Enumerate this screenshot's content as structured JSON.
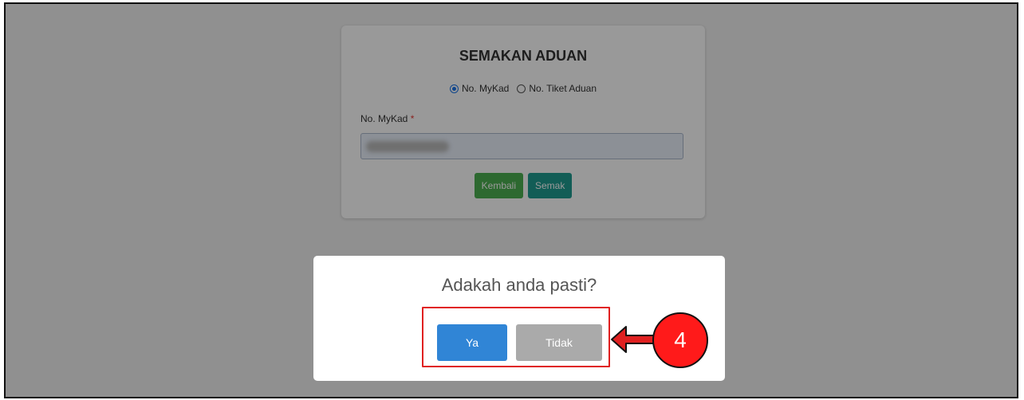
{
  "form": {
    "title": "SEMAKAN ADUAN",
    "radio_options": [
      {
        "label": "No. MyKad",
        "checked": true
      },
      {
        "label": "No. Tiket Aduan",
        "checked": false
      }
    ],
    "field_label": "No. MyKad",
    "required_mark": "*",
    "field_value": "",
    "back_label": "Kembali",
    "check_label": "Semak"
  },
  "dialog": {
    "title": "Adakah anda pasti?",
    "confirm_label": "Ya",
    "cancel_label": "Tidak"
  },
  "annotation": {
    "step_number": "4",
    "color": "#ff1a1a"
  },
  "colors": {
    "confirm": "#3085d6",
    "cancel": "#aaaaaa",
    "back": "#4caf50",
    "check": "#1e9b8f"
  }
}
